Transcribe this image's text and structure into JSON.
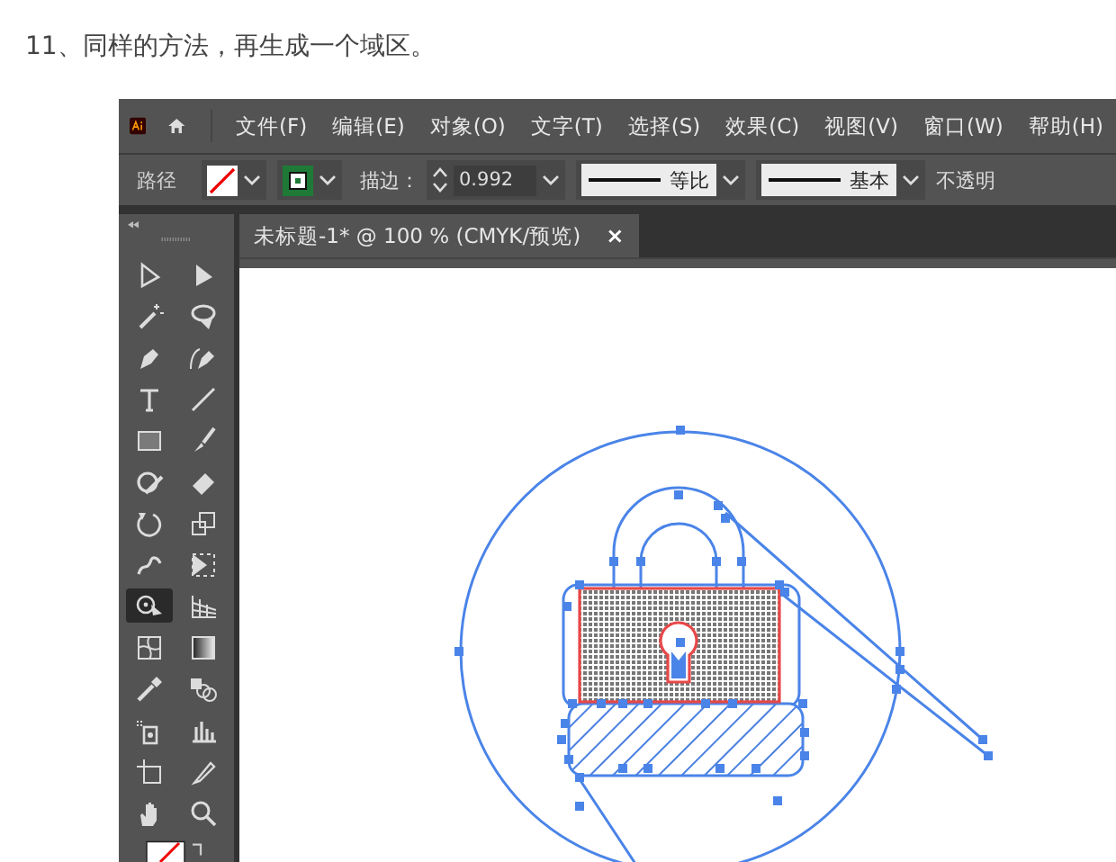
{
  "article": {
    "step_text": "11、同样的方法，再生成一个域区。"
  },
  "app": {
    "menu": [
      "文件(F)",
      "编辑(E)",
      "对象(O)",
      "文字(T)",
      "选择(S)",
      "效果(C)",
      "视图(V)",
      "窗口(W)",
      "帮助(H)"
    ],
    "control_bar": {
      "selection_label": "路径",
      "stroke_label": "描边：",
      "stroke_weight": "0.992",
      "profile": "等比",
      "brush": "基本",
      "opacity_label": "不透明"
    },
    "document_tab": {
      "title": "未标题-1* @ 100 % (CMYK/预览)",
      "close": "×"
    },
    "tools": [
      {
        "selected": false
      },
      {
        "selected": false
      },
      {
        "selected": false
      },
      {
        "selected": false
      },
      {
        "selected": false
      },
      {
        "selected": false
      },
      {
        "selected": false
      },
      {
        "selected": false
      },
      {
        "selected": false
      },
      {
        "selected": false
      },
      {
        "selected": false
      },
      {
        "selected": false
      },
      {
        "selected": false
      },
      {
        "selected": false
      },
      {
        "selected": false
      },
      {
        "selected": false
      },
      {
        "selected": true
      },
      {
        "selected": false
      },
      {
        "selected": false
      },
      {
        "selected": false
      },
      {
        "selected": false
      },
      {
        "selected": false
      },
      {
        "selected": false
      },
      {
        "selected": false
      },
      {
        "selected": false
      },
      {
        "selected": false
      },
      {
        "selected": false
      },
      {
        "selected": false
      }
    ]
  }
}
